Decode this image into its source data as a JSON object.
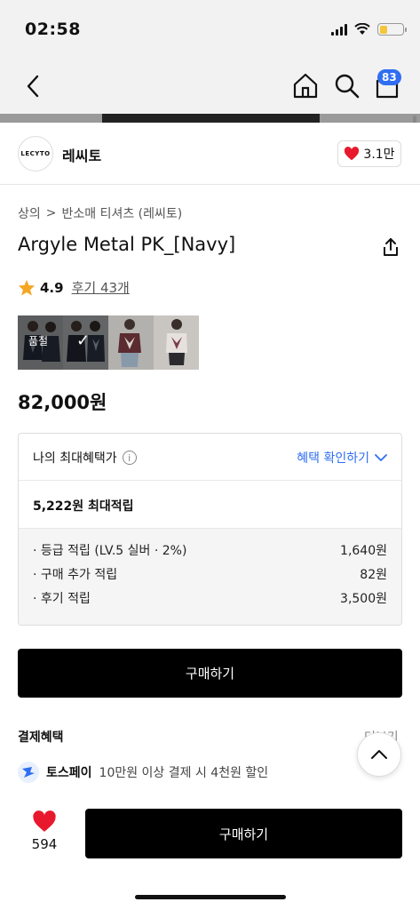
{
  "status_bar": {
    "time": "02:58"
  },
  "nav": {
    "cart_badge": "83"
  },
  "brand": {
    "logo_text": "LECYTO",
    "name": "레씨토",
    "likes": "3.1만"
  },
  "breadcrumb": {
    "level1": "상의",
    "separator": ">",
    "level2": "반소매 티셔츠 (레씨토)"
  },
  "product": {
    "title": "Argyle Metal PK_[Navy]",
    "rating": "4.9",
    "reviews": "후기 43개",
    "thumb_label": "품절",
    "price": "82,000원"
  },
  "benefits": {
    "title": "나의 최대혜택가",
    "info_symbol": "i",
    "check_link": "혜택 확인하기",
    "total": "5,222원 최대적립",
    "items": [
      {
        "label": "· 등급 적립 (LV.5 실버 · 2%)",
        "value": "1,640원"
      },
      {
        "label": "· 구매 추가 적립",
        "value": "82원"
      },
      {
        "label": "· 후기 적립",
        "value": "3,500원"
      }
    ]
  },
  "buy_button": "구매하기",
  "payment": {
    "heading": "결제혜택",
    "more": "더보기",
    "toss_name": "토스페이",
    "toss_desc": "10만원 이상 결제 시 4천원 할인"
  },
  "bottom_bar": {
    "like_count": "594",
    "buy_label": "구매하기"
  },
  "colors": {
    "accent_blue": "#2f6ef0",
    "heart_red": "#e8192c",
    "star": "#f5a623",
    "button_black": "#000000"
  }
}
